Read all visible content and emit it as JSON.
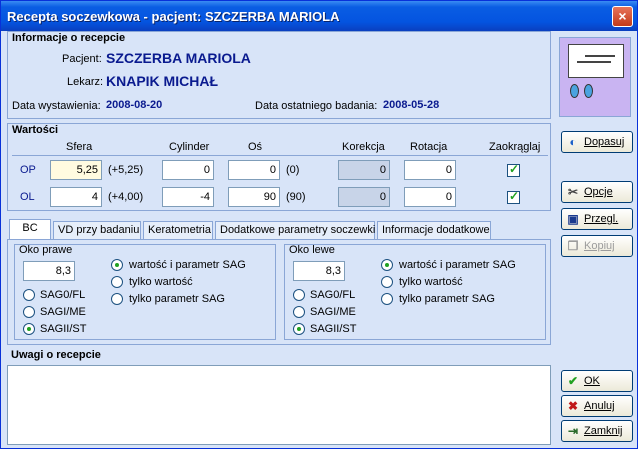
{
  "window": {
    "title": "Recepta soczewkowa - pacjent: SZCZERBA MARIOLA",
    "close_label": "×"
  },
  "info": {
    "title": "Informacje o recepcie",
    "patient_label": "Pacjent:",
    "patient": "SZCZERBA MARIOLA",
    "doctor_label": "Lekarz:",
    "doctor": "KNAPIK MICHAŁ",
    "issued_label": "Data wystawienia:",
    "issued": "2008-08-20",
    "exam_label": "Data ostatniego badania:",
    "exam": "2008-05-28"
  },
  "values": {
    "title": "Wartości",
    "headers": {
      "sfera": "Sfera",
      "cylinder": "Cylinder",
      "os": "Oś",
      "korekcja": "Korekcja",
      "rotacja": "Rotacja",
      "zaokraglaj": "Zaokrąglaj"
    },
    "rows": [
      {
        "label": "OP",
        "sfera": "5,25",
        "sfera_hint": "(+5,25)",
        "cylinder": "0",
        "os": "0",
        "os_hint": "(0)",
        "korekcja": "0",
        "rotacja": "0",
        "round": true
      },
      {
        "label": "OL",
        "sfera": "4",
        "sfera_hint": "(+4,00)",
        "cylinder": "-4",
        "os": "90",
        "os_hint": "(90)",
        "korekcja": "0",
        "rotacja": "0",
        "round": true
      }
    ]
  },
  "tabs": [
    "BC",
    "VD przy badaniu",
    "Keratometria",
    "Dodatkowe parametry soczewki",
    "Informacje dodatkowe"
  ],
  "active_tab": "BC",
  "bc": {
    "right": {
      "title": "Oko prawe",
      "value": "8,3"
    },
    "left": {
      "title": "Oko lewe",
      "value": "8,3"
    },
    "radio_sag": [
      "SAG0/FL",
      "SAGI/ME",
      "SAGII/ST"
    ],
    "radio_mode": [
      "wartość i parametr SAG",
      "tylko wartość",
      "tylko parametr SAG"
    ]
  },
  "notes": {
    "title": "Uwagi o recepcie",
    "value": ""
  },
  "buttons": {
    "dopasuj": "Dopasuj",
    "opcje": "Opcje",
    "przegl": "Przegl.",
    "kopiuj": "Kopiuj",
    "ok": "OK",
    "anuluj": "Anuluj",
    "zamknij": "Zamknij"
  },
  "colors": {
    "titlebar": "#0454e0",
    "panel": "#d8e4f8",
    "accent_text": "#0a1a8f"
  }
}
